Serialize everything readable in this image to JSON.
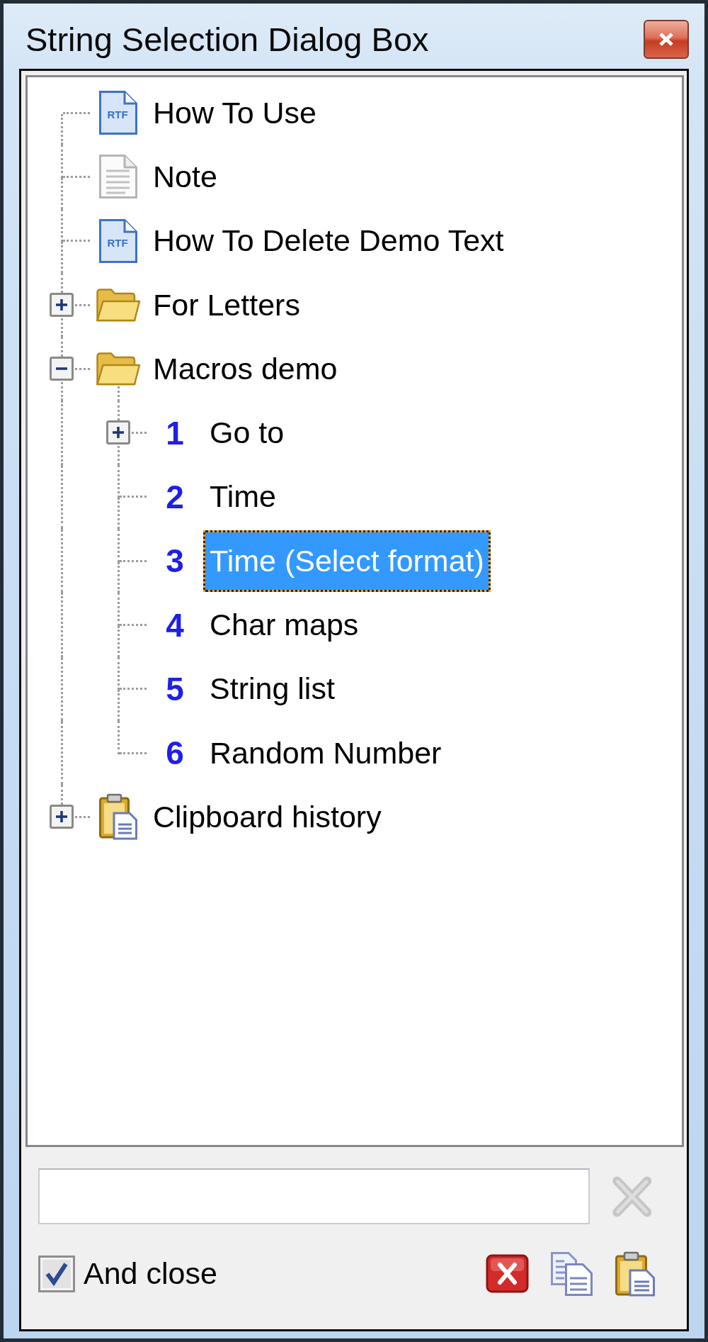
{
  "window": {
    "title": "String Selection Dialog Box"
  },
  "tree": [
    {
      "label": "How To Use",
      "kind": "rtf",
      "icon_text": "RTF",
      "selected": false
    },
    {
      "label": "Note",
      "kind": "note",
      "selected": false
    },
    {
      "label": "How To Delete Demo Text",
      "kind": "rtf",
      "icon_text": "RTF",
      "selected": false
    },
    {
      "label": "For Letters",
      "kind": "folder",
      "expanded": false,
      "selected": false
    },
    {
      "label": "Macros demo",
      "kind": "folder",
      "expanded": true,
      "selected": false,
      "children": [
        {
          "number": "1",
          "label": "Go to",
          "kind": "macro",
          "expanded": false,
          "selected": false
        },
        {
          "number": "2",
          "label": "Time",
          "kind": "macro",
          "selected": false
        },
        {
          "number": "3",
          "label": "Time (Select format)",
          "kind": "macro",
          "selected": true
        },
        {
          "number": "4",
          "label": "Char maps",
          "kind": "macro",
          "selected": false
        },
        {
          "number": "5",
          "label": "String list",
          "kind": "macro",
          "selected": false
        },
        {
          "number": "6",
          "label": "Random Number",
          "kind": "macro",
          "selected": false
        }
      ]
    },
    {
      "label": "Clipboard history",
      "kind": "clipboard",
      "expanded": false,
      "selected": false
    }
  ],
  "filter": {
    "clear_button": {
      "disabled": true
    }
  },
  "close_option": {
    "label": "And close",
    "checked": true
  },
  "actions": [
    {
      "kind": "delete"
    },
    {
      "kind": "copy"
    },
    {
      "kind": "paste"
    }
  ]
}
